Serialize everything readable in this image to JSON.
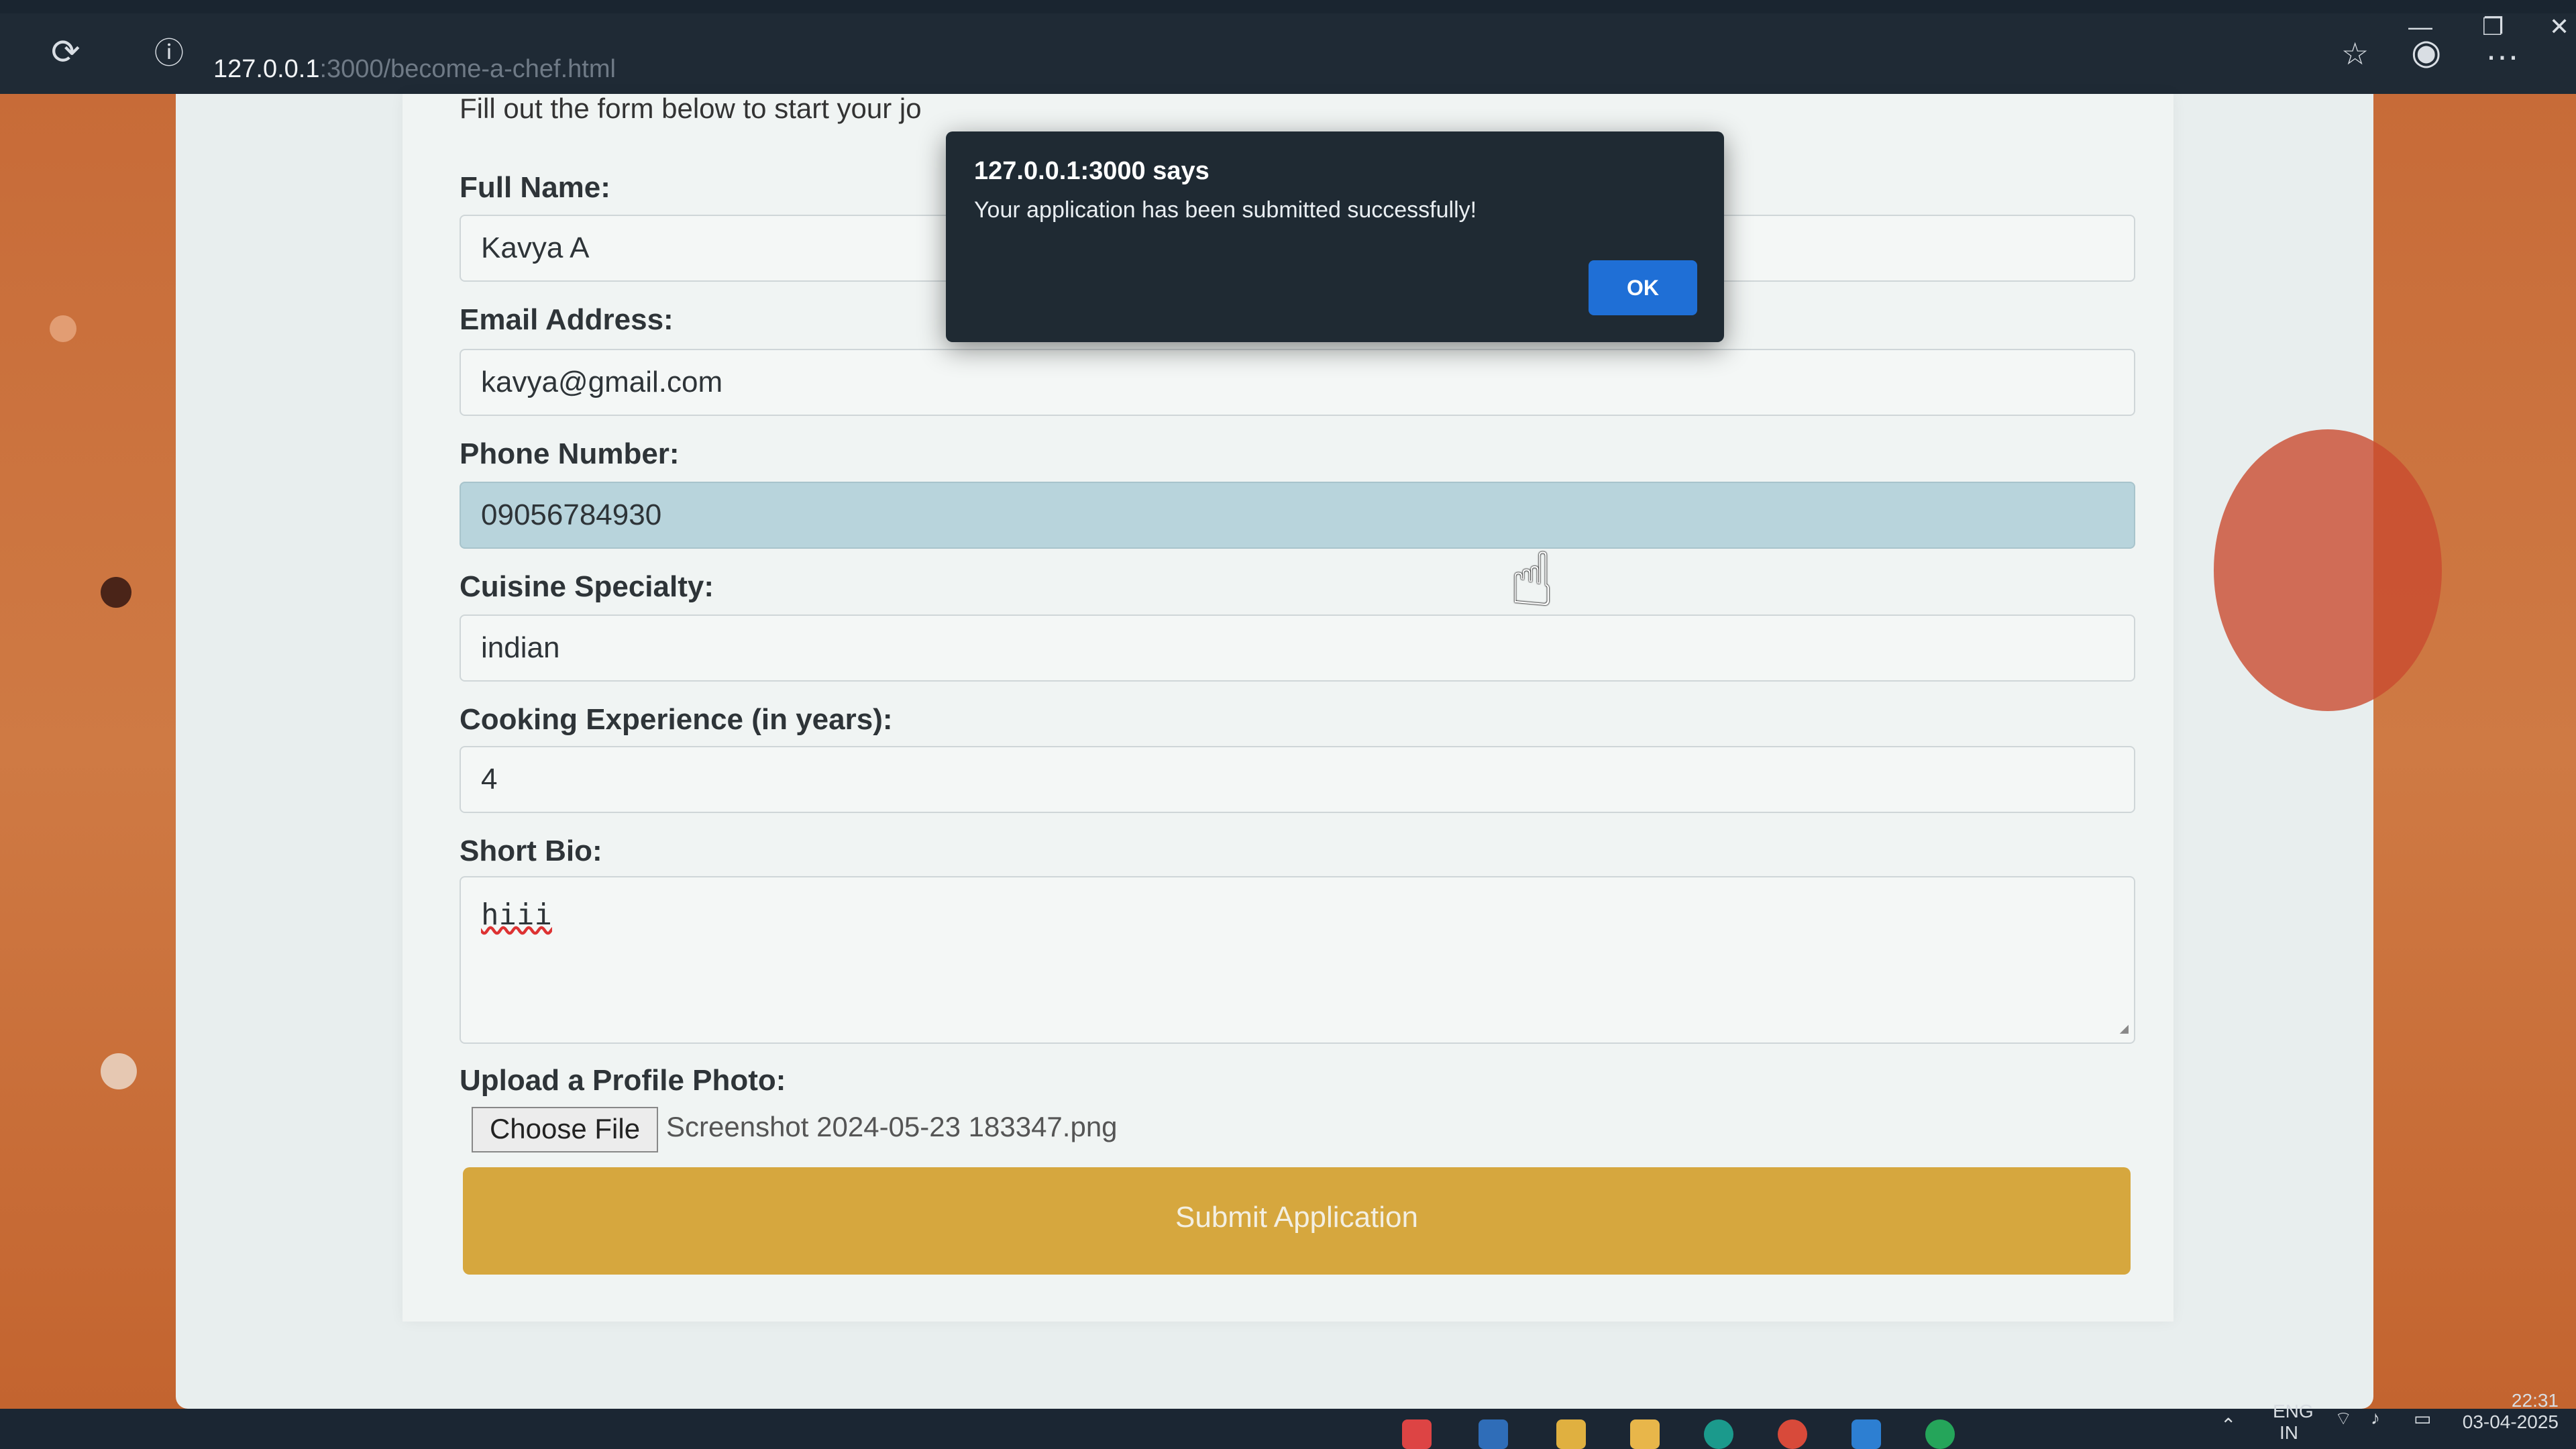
{
  "browser": {
    "url_host": "127.0.0.1",
    "url_rest": ":3000/become-a-chef.html",
    "icons": [
      "reload-icon",
      "info-icon",
      "favorites-icon",
      "profile-icon",
      "more-icon",
      "minimize-icon",
      "maximize-icon",
      "close-icon"
    ]
  },
  "page": {
    "intro_text": "Fill out the form below to start your jo",
    "fields": {
      "full_name_label": "Full Name:",
      "full_name_value": "Kavya A",
      "email_label": "Email Address:",
      "email_value": "kavya@gmail.com",
      "phone_label": "Phone Number:",
      "phone_value": "09056784930",
      "cuisine_label": "Cuisine Specialty:",
      "cuisine_value": "indian",
      "experience_label": "Cooking Experience (in years):",
      "experience_value": "4",
      "bio_label": "Short Bio:",
      "bio_value": "hiii",
      "upload_label": "Upload a Profile Photo:",
      "choose_file_label": "Choose File",
      "file_name": "Screenshot 2024-05-23 183347.png"
    },
    "submit_label": "Submit Application"
  },
  "dialog": {
    "title": "127.0.0.1:3000 says",
    "message": "Your application has been submitted successfully!",
    "ok_label": "OK"
  },
  "taskbar": {
    "lang_top": "ENG",
    "lang_bottom": "IN",
    "time": "22:31",
    "date": "03-04-2025"
  },
  "colors": {
    "accent_submit": "#d6a73e",
    "dialog_bg": "#1f2a33",
    "ok_button": "#1f6fd6",
    "phone_highlight": "#b8d4dc"
  }
}
